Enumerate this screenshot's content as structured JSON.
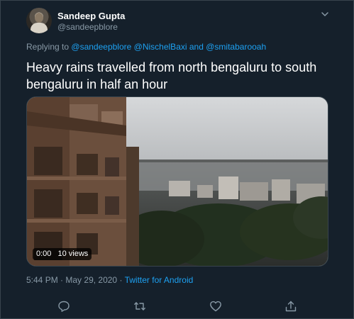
{
  "author": {
    "name": "Sandeep Gupta",
    "handle": "@sandeepblore"
  },
  "reply": {
    "prefix": "Replying to",
    "mentions": [
      "@sandeepblore",
      "@NischelBaxi",
      "and",
      "@smitabarooah"
    ]
  },
  "tweet": {
    "text": "Heavy rains travelled from north bengaluru to south bengaluru in half an hour"
  },
  "video": {
    "duration": "0:00",
    "views": "10 views"
  },
  "meta": {
    "time": "5:44 PM",
    "separator": "·",
    "date": "May 29, 2020",
    "source": "Twitter for Android"
  },
  "icons": {
    "more": "chevron-down-icon",
    "reply": "reply-icon",
    "retweet": "retweet-icon",
    "like": "heart-icon",
    "share": "share-icon"
  },
  "colors": {
    "background": "#15202b",
    "border": "#38444d",
    "secondary_text": "#8899a6",
    "link": "#1da1f2"
  }
}
